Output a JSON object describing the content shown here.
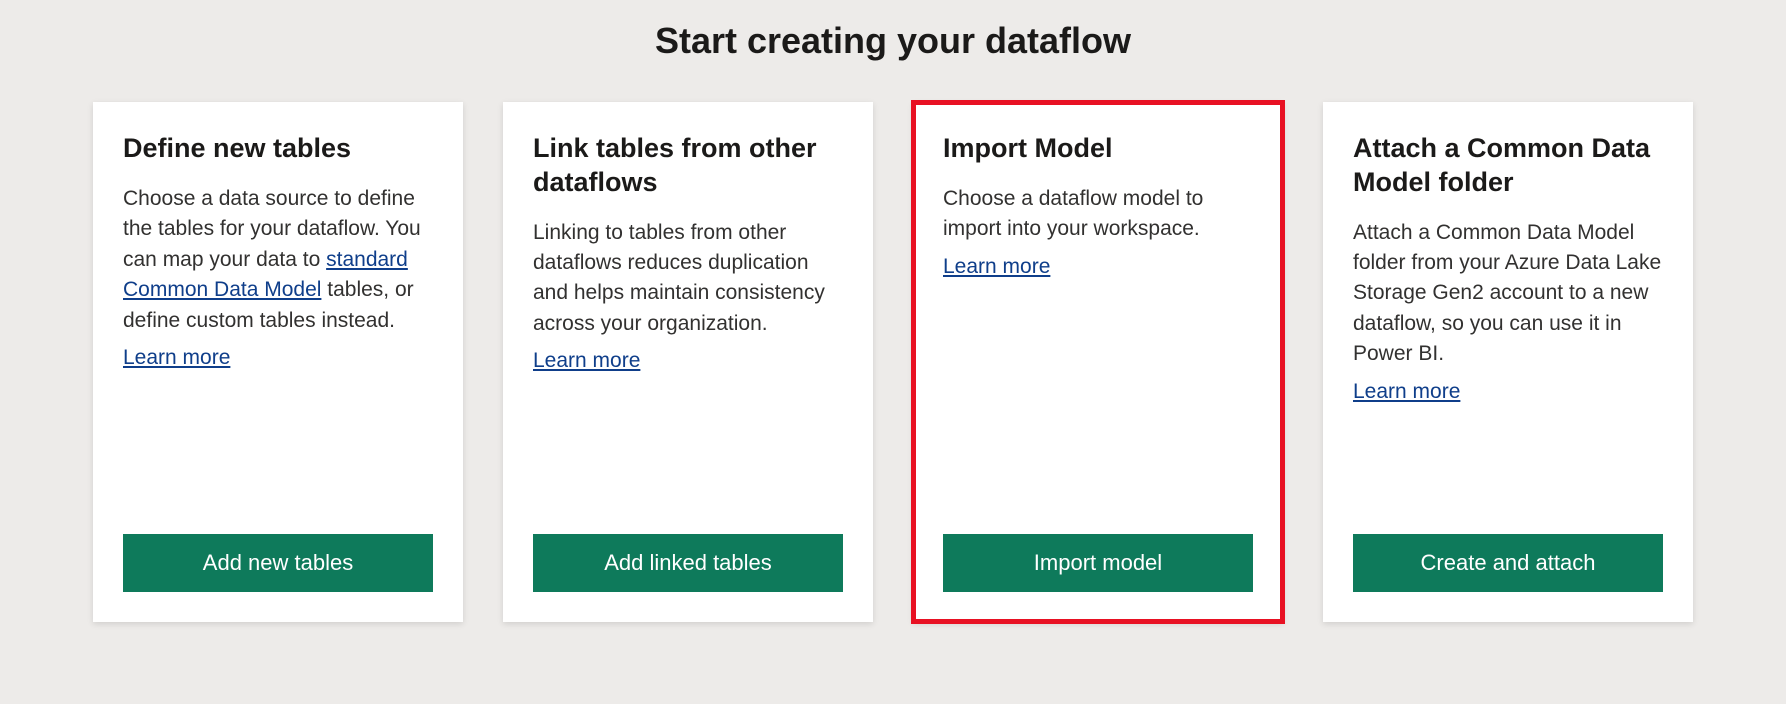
{
  "page": {
    "title": "Start creating your dataflow"
  },
  "cards": [
    {
      "title": "Define new tables",
      "desc_pre": "Choose a data source to define the tables for your dataflow. You can map your data to ",
      "desc_link": "standard Common Data Model",
      "desc_post": " tables, or define custom tables instead.",
      "learn_more": "Learn more",
      "button": "Add new tables"
    },
    {
      "title": "Link tables from other dataflows",
      "desc_pre": "Linking to tables from other dataflows reduces duplication and helps maintain consistency across your organization.",
      "desc_link": "",
      "desc_post": "",
      "learn_more": "Learn more",
      "button": "Add linked tables"
    },
    {
      "title": "Import Model",
      "desc_pre": "Choose a dataflow model to import into your workspace.",
      "desc_link": "",
      "desc_post": "",
      "learn_more": "Learn more",
      "button": "Import model"
    },
    {
      "title": "Attach a Common Data Model folder",
      "desc_pre": "Attach a Common Data Model folder from your Azure Data Lake Storage Gen2 account to a new dataflow, so you can use it in Power BI.",
      "desc_link": "",
      "desc_post": "",
      "learn_more": "Learn more",
      "button": "Create and attach"
    }
  ]
}
